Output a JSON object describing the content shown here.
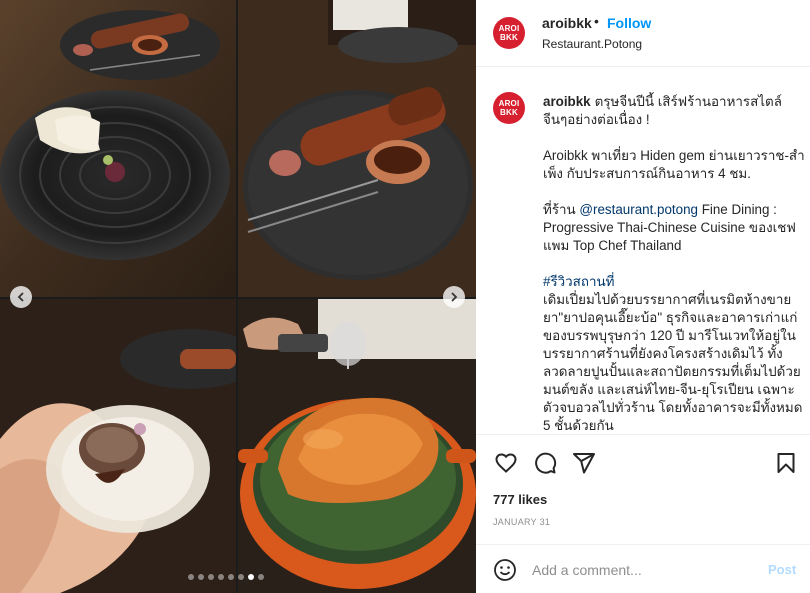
{
  "post": {
    "username": "aroibkk",
    "follow_label": "Follow",
    "separator": "•",
    "location": "Restaurant.Potong",
    "avatar_text_1": "AROI",
    "avatar_text_2": "BKK"
  },
  "caption": {
    "username": "aroibkk",
    "line1": "ตรุษจีนปีนี้ เสิร์ฟร้านอาหารสไตล์จีนๆอย่างต่อเนื่อง !",
    "para2": "Aroibkk พาเที่ยว Hiden gem ย่านเยาวราช-สำเพ็ง กับประสบการณ์กินอาหาร 4 ชม.",
    "para3_prefix": "ที่ร้าน ",
    "para3_mention": "@restaurant.potong",
    "para3_suffix": " Fine Dining : Progressive Thai-Chinese Cuisine ของเชฟแพม Top Chef Thailand",
    "hashtag": "#รีวิวสถานที่",
    "para4": "เดิมเปี่ยมไปด้วยบรรยากาศที่เนรมิตห้างขายยา\"ยาปอคุนเอี๊ยะบ้อ\" ธุรกิจและอาคารเก่าแก่ของบรรพบุรุษกว่า 120 ปี มารีโนเวทให้อยู่ในบรรยากาศร้านที่ยังคงโครงสร้างเดิมไว้ ทั้งลวดลายปูนปั้นและสถาปัตยกรรมที่เต็มไปด้วยมนต์ขลัง และเสน่ห์ไทย-จีน-ยุโรเปียน เฉพาะตัวจบอวลไปทั่วร้าน โดยทั้งอาคารจะมีทั้งหมด 5 ชั้นด้วยกัน"
  },
  "stats": {
    "likes": "777 likes",
    "date": "JANUARY 31"
  },
  "comment": {
    "placeholder": "Add a comment...",
    "post_label": "Post"
  },
  "icons": [
    "heart-icon",
    "comment-icon",
    "share-icon",
    "bookmark-icon",
    "emoji-icon",
    "chevron-left-icon",
    "chevron-right-icon"
  ],
  "carousel": {
    "count": 8,
    "active_index": 6
  },
  "colors": {
    "brand": "#d6202f",
    "link": "#00376b",
    "follow": "#0095f6",
    "post_disabled": "#b3dbff"
  }
}
